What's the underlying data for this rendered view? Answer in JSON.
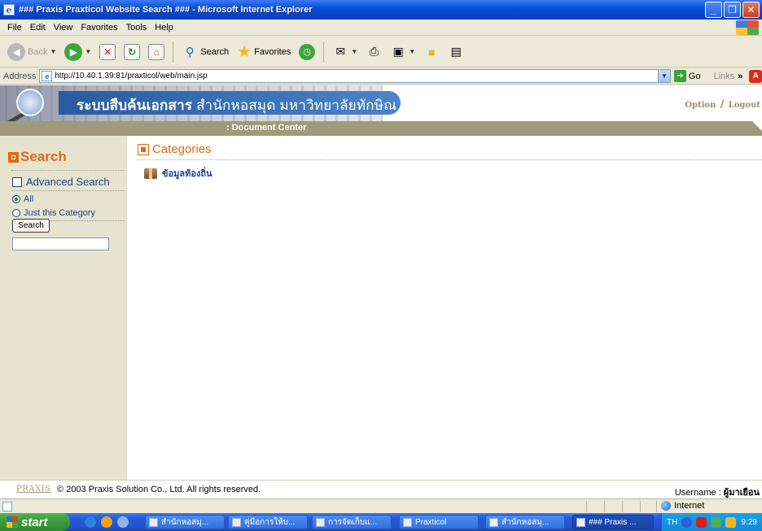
{
  "window": {
    "title": "### Praxis Praxticol Website Search ### - Microsoft Internet Explorer"
  },
  "menu": [
    "File",
    "Edit",
    "View",
    "Favorites",
    "Tools",
    "Help"
  ],
  "toolbar": {
    "back_label": "Back",
    "search_label": "Search",
    "favorites_label": "Favorites"
  },
  "address": {
    "label": "Address",
    "url": "http://10.40.1.39:81/praxticol/web/main.jsp",
    "go_label": "Go",
    "links_label": "Links",
    "links_more": "»"
  },
  "banner": {
    "title_bold": "ระบบสืบค้นเอกสาร",
    "title_thin": "สำนักหอสมุด มหาวิทยาลัยทักษิณ",
    "option_link": "Option",
    "slash": "/",
    "logout_link": "Logout",
    "subtitle": ": Document Center"
  },
  "sidebar": {
    "title": "Search",
    "advanced_label": "Advanced Search",
    "advanced_checked": false,
    "radio_all": "All",
    "radio_category": "Just this Category",
    "selected": "All",
    "search_button": "Search",
    "search_value": ""
  },
  "main": {
    "header": "Categories",
    "items": [
      {
        "label": "ข้อมูลท้องถิ่น"
      }
    ]
  },
  "footer": {
    "brand": "PRAXIS",
    "copyright": "© 2003 Praxis Solution Co., Ltd. All rights reserved.",
    "username_label": "Username :",
    "username_value": "ผู้มาเยือน"
  },
  "status": {
    "zone": "Internet"
  },
  "taskbar": {
    "start_label": "start",
    "tasks": [
      {
        "label": "สำนักหอสมุ...",
        "active": false
      },
      {
        "label": "คู่มือการให้บ...",
        "active": false
      },
      {
        "label": "การจัดเก็บแ...",
        "active": false
      },
      {
        "label": "Praxticol",
        "active": false
      },
      {
        "label": "สำนักหอสมุ...",
        "active": false
      },
      {
        "label": "### Praxis ...",
        "active": true
      }
    ],
    "lang": "TH",
    "clock": "9:29"
  }
}
